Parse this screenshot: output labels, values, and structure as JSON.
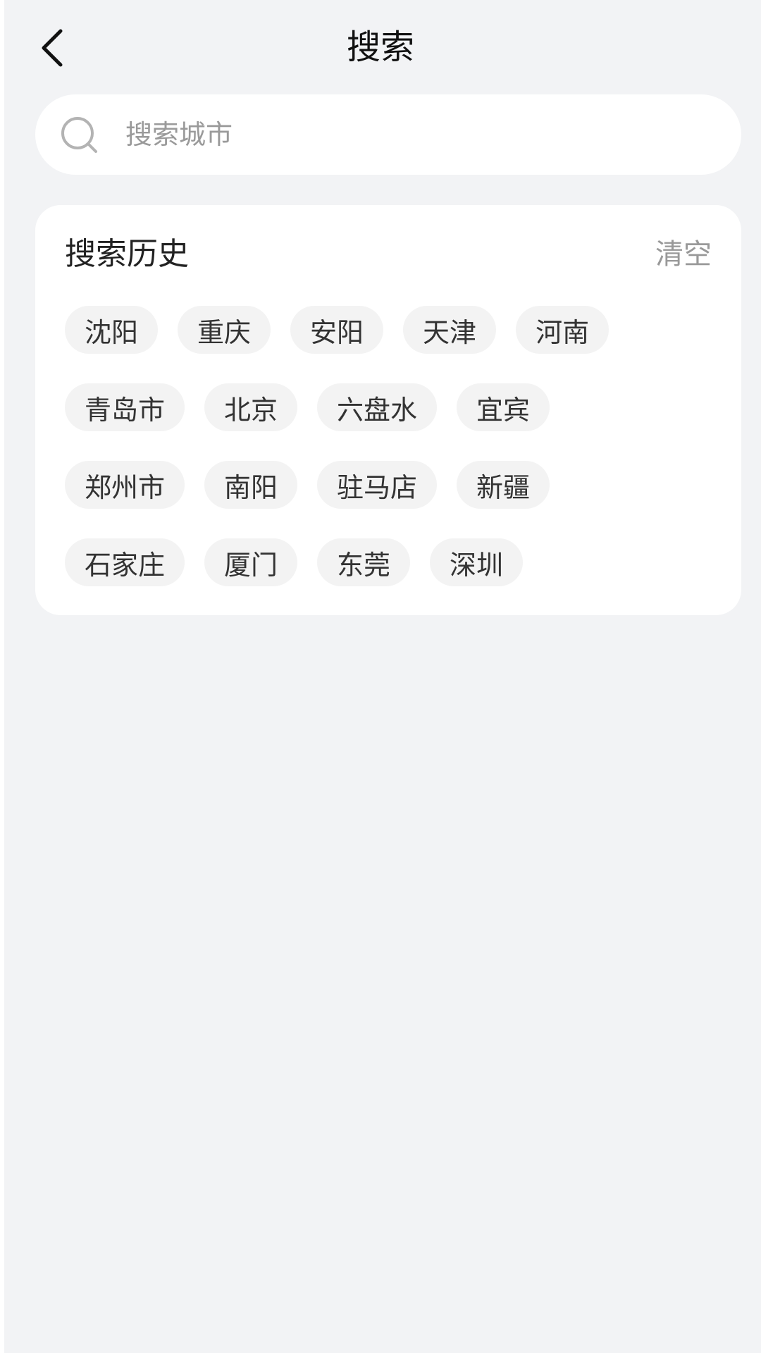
{
  "header": {
    "title": "搜索",
    "back_icon": "chevron-left-icon"
  },
  "search": {
    "placeholder": "搜索城市",
    "icon": "search-icon"
  },
  "history": {
    "title": "搜索历史",
    "clear_label": "清空",
    "rows": [
      [
        "沈阳",
        "重庆",
        "安阳",
        "天津",
        "河南"
      ],
      [
        "青岛市",
        "北京",
        "六盘水",
        "宜宾"
      ],
      [
        "郑州市",
        "南阳",
        "驻马店",
        "新疆"
      ],
      [
        "石家庄",
        "厦门",
        "东莞",
        "深圳"
      ]
    ]
  },
  "colors": {
    "background": "#f2f3f5",
    "card": "#ffffff",
    "tag_bg": "#f3f3f3",
    "muted_text": "#999999"
  }
}
